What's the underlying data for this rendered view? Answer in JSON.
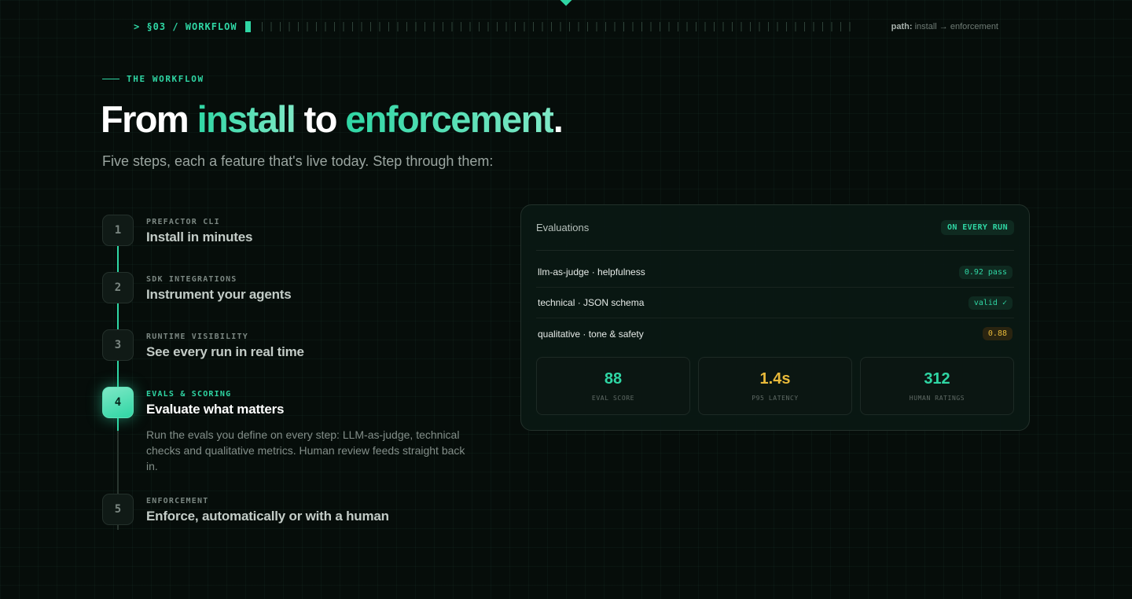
{
  "section": {
    "label": "> §03 / WORKFLOW",
    "path_key": "path:",
    "path_value": "install → enforcement"
  },
  "eyebrow": "THE WORKFLOW",
  "headline": {
    "part1": "From ",
    "accent1": "install",
    "part2": " to ",
    "accent2": "enforcement",
    "part3": "."
  },
  "subhead": "Five steps, each a feature that's live today. Step through them:",
  "steps": [
    {
      "number": "1",
      "kicker": "PREFACTOR CLI",
      "title": "Install in minutes"
    },
    {
      "number": "2",
      "kicker": "SDK INTEGRATIONS",
      "title": "Instrument your agents"
    },
    {
      "number": "3",
      "kicker": "RUNTIME VISIBILITY",
      "title": "See every run in real time"
    },
    {
      "number": "4",
      "kicker": "EVALS & SCORING",
      "title": "Evaluate what matters",
      "description": "Run the evals you define on every step: LLM-as-judge, technical checks and qualitative metrics. Human review feeds straight back in."
    },
    {
      "number": "5",
      "kicker": "ENFORCEMENT",
      "title": "Enforce, automatically or with a human"
    }
  ],
  "active_step": 4,
  "panel": {
    "title": "Evaluations",
    "pill": "ON EVERY RUN",
    "rows": [
      {
        "name": "llm-as-judge · helpfulness",
        "tag": "0.92 pass"
      },
      {
        "name": "technical · JSON schema",
        "tag": "valid ✓"
      },
      {
        "name": "qualitative · tone & safety",
        "tag": "0.88"
      }
    ],
    "stats": [
      {
        "value": "88",
        "label": "EVAL SCORE"
      },
      {
        "value": "1.4s",
        "label": "P95 LATENCY"
      },
      {
        "value": "312",
        "label": "HUMAN RATINGS"
      }
    ]
  },
  "colors": {
    "accent": "#2fd6a4",
    "warning": "#e8b93a",
    "background": "#060d0a"
  }
}
